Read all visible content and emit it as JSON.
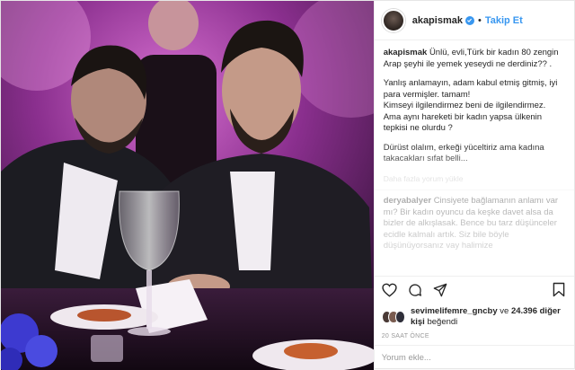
{
  "header": {
    "username": "akapismak",
    "separator": "•",
    "follow_label": "Takip Et"
  },
  "caption": {
    "username": "akapismak",
    "first_line": "Ünlü, evli,Türk bir kadın 80 zengin Arap şeyhi ile yemek yeseydi ne derdiniz?? .",
    "paragraph_1": "Yanlış anlamayın, adam kabul etmiş gitmiş, iyi para vermişler. tamam!\nKimseyi ilgilendirmez beni de ilgilendirmez.\nAma aynı hareketi bir kadın yapsa ülkenin tepkisi ne olurdu ?",
    "paragraph_2": "Dürüst olalım, erkeği yüceltiriz ama kadına takacakları sıfat belli..."
  },
  "load_more": "Daha fazla yorum yükle",
  "comment": {
    "username": "deryabalyer",
    "text": "Cinsiyete bağlamanın anlamı var mı? Bir kadın oyuncu da keşke davet alsa da bizler de alkışlasak. Bence bu tarz düşünceler ecidle kalmalı artık. Siz bile böyle düşünüyorsanız vay halimize"
  },
  "likes": {
    "first_user": "sevimelifemre_gncby",
    "connector": "ve",
    "count_text": "24.396 diğer kişi",
    "suffix": "beğendi"
  },
  "timestamp": "20 SAAT ÖNCE",
  "add_comment": {
    "placeholder": "Yorum ekle..."
  },
  "icons": {
    "like": "heart-icon",
    "comment": "comment-bubble-icon",
    "share": "share-plane-icon",
    "save": "bookmark-icon",
    "verified": "verified-badge-icon"
  },
  "colors": {
    "accent": "#3897f0",
    "text": "#262626",
    "muted": "#999999",
    "border": "#efefef"
  }
}
